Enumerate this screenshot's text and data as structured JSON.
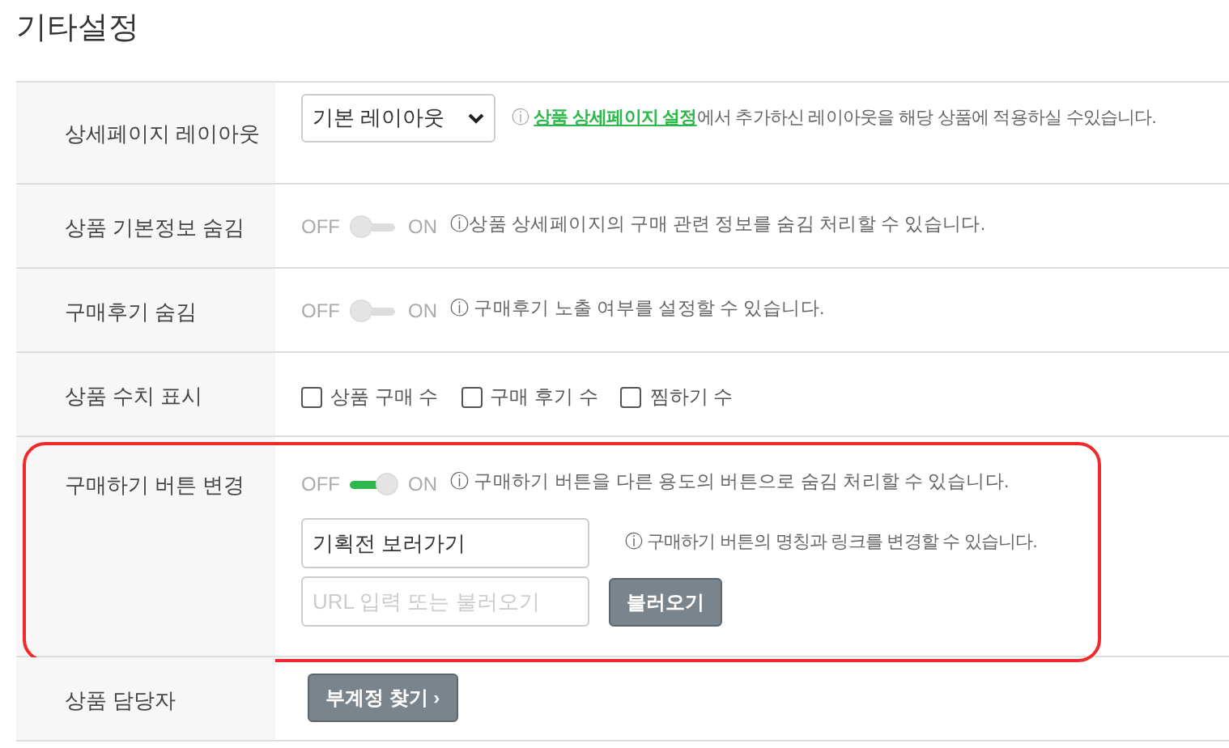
{
  "title": "기타설정",
  "rows": [
    {
      "kind": "select",
      "label": "상세페이지 레이아웃",
      "select": {
        "value": "기본 레이아웃"
      },
      "hint": {
        "icon": "ⓘ",
        "link": "상품 상세페이지 설정",
        "text": "에서 추가하신 레이아웃을 해당 상품에 적용하실 수있습니다."
      }
    },
    {
      "kind": "toggle",
      "label": "상품 기본정보 숨김",
      "off_label": "OFF",
      "on_label": "ON",
      "on": false,
      "hint": {
        "text": "ⓘ상품 상세페이지의 구매 관련 정보를 숨김 처리할 수 있습니다."
      }
    },
    {
      "kind": "toggle",
      "label": "구매후기 숨김",
      "off_label": "OFF",
      "on_label": "ON",
      "on": false,
      "hint": {
        "text": "ⓘ 구매후기 노출 여부를 설정할 수 있습니다."
      }
    },
    {
      "kind": "checkboxes",
      "label": "상품 수치 표시",
      "options": [
        {
          "label": "상품 구매 수",
          "checked": false
        },
        {
          "label": "구매 후기 수",
          "checked": false
        },
        {
          "label": "찜하기 수",
          "checked": false
        }
      ]
    },
    {
      "kind": "button_change",
      "label": "구매하기 버튼 변경",
      "highlighted": true,
      "off_label": "OFF",
      "on_label": "ON",
      "on": true,
      "hint": {
        "text": "ⓘ 구매하기 버튼을 다른 용도의 버튼으로 숨김 처리할 수 있습니다."
      },
      "name_field": {
        "value": "기획전 보러가기"
      },
      "name_hint": "ⓘ 구매하기 버튼의 명칭과 링크를 변경할 수 있습니다.",
      "url_field": {
        "placeholder": "URL 입력 또는 불러오기"
      },
      "load_button": "불러오기"
    },
    {
      "kind": "button",
      "label": "상품 담당자",
      "button": "부계정 찾기 ›"
    }
  ]
}
